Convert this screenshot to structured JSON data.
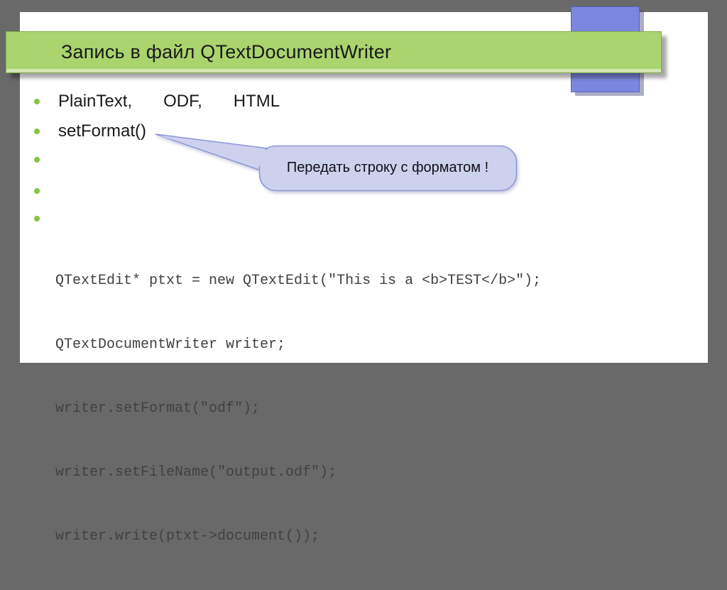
{
  "slide": {
    "title": "Запись в файл QTextDocumentWriter",
    "bullets": [
      {
        "parts": [
          "PlainText,",
          "ODF,",
          "HTML"
        ]
      },
      {
        "parts": [
          "setFormat()"
        ]
      },
      {
        "parts": []
      },
      {
        "parts": []
      },
      {
        "parts": []
      }
    ],
    "callout": {
      "text": "Передать строку с форматом !"
    },
    "code_lines": [
      "QTextEdit* ptxt = new QTextEdit(\"This is a <b>TEST</b>\");",
      "QTextDocumentWriter writer;",
      "writer.setFormat(\"odf\");",
      "writer.setFileName(\"output.odf\");",
      "writer.write(ptxt->document());"
    ]
  },
  "colors": {
    "background": "#696969",
    "slide_bg": "#ffffff",
    "banner_green": "#a9d46e",
    "banner_border": "#7fae49",
    "accent_blue": "#7b87de",
    "accent_blue_border": "#5560c0",
    "bullet_green": "#85c440",
    "callout_fill": "#ccd1ee",
    "callout_border": "#8d97d6",
    "text_dark": "#1a1a1a",
    "code_gray": "#414141"
  }
}
